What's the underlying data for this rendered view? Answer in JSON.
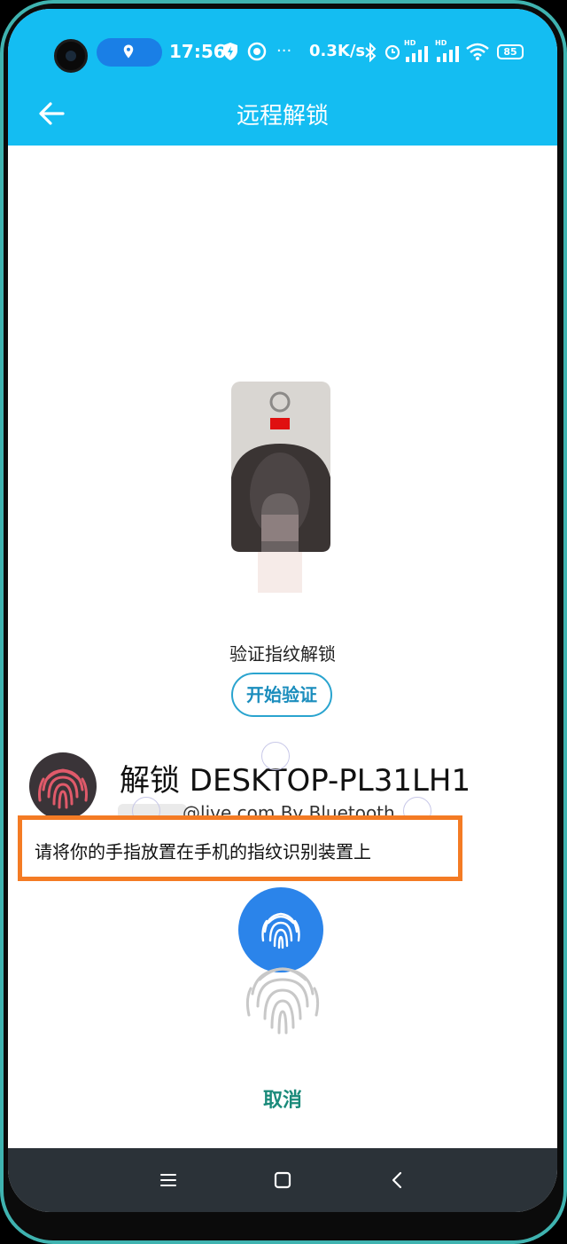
{
  "status_bar": {
    "time": "17:56",
    "dots": "···",
    "net_speed": "0.3K/s",
    "hd_label": "HD",
    "battery": "85"
  },
  "app_bar": {
    "title": "远程解锁"
  },
  "verify": {
    "label": "验证指纹解锁",
    "start_button": "开始验证"
  },
  "unlock": {
    "title": "解锁 DESKTOP-PL31LH1",
    "subtitle": "@live.com By Bluetooth"
  },
  "prompt": {
    "instruction": "请将你的手指放置在手机的指纹识别装置上"
  },
  "actions": {
    "cancel": "取消"
  },
  "colors": {
    "accent_blue": "#14bdf2",
    "fingerprint_button": "#2b84ea",
    "highlight_orange": "#f47b24",
    "cancel_green": "#1a8a7a",
    "nav_bar": "#2b3238",
    "phone_frame": "#3fb3b0"
  },
  "icons": {
    "back": "arrow-left-icon",
    "location": "location-pin-icon",
    "fingerprint": "fingerprint-icon",
    "nav_menu": "menu-icon",
    "nav_home": "square-icon",
    "nav_back": "chevron-left-icon"
  }
}
